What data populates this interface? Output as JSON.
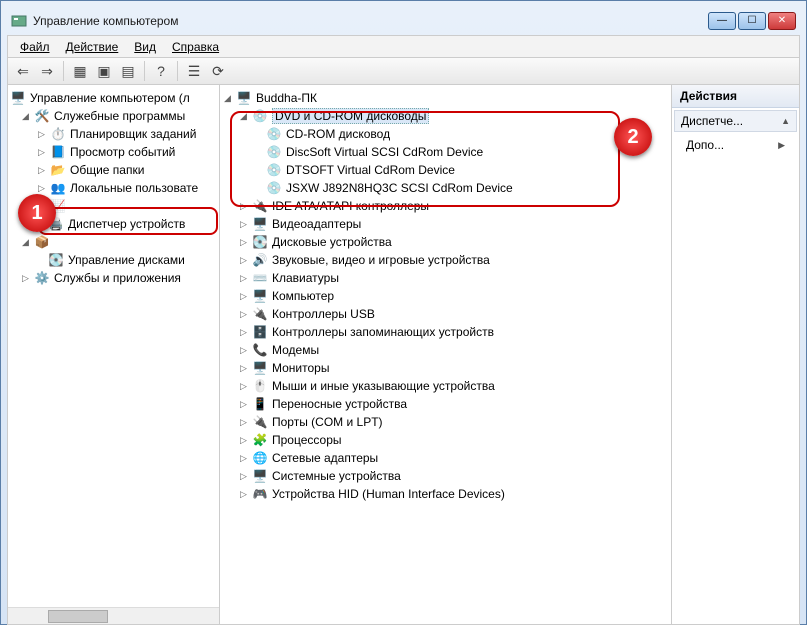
{
  "window": {
    "title": "Управление компьютером"
  },
  "menu": {
    "file": "Файл",
    "action": "Действие",
    "view": "Вид",
    "help": "Справка"
  },
  "left_tree": {
    "root": "Управление компьютером (л",
    "system_tools": "Служебные программы",
    "task_scheduler": "Планировщик заданий",
    "event_viewer": "Просмотр событий",
    "shared_folders": "Общие папки",
    "local_users": "Локальные пользовате",
    "perf": " ",
    "device_manager": "Диспетчер устройств",
    "storage": " ",
    "disk_mgmt": "Управление дисками",
    "services": "Службы и приложения"
  },
  "dev_tree": {
    "root": "Buddha-ПК",
    "dvd_cdrom": "DVD и CD-ROM дисководы",
    "cdrom": "CD-ROM дисковод",
    "discsoft": "DiscSoft Virtual SCSI CdRom Device",
    "dtsoft": "DTSOFT Virtual CdRom Device",
    "jsxw": "JSXW J892N8HQ3C SCSI CdRom Device",
    "ide": "IDE ATA/ATAPI контроллеры",
    "video": "Видеоадаптеры",
    "disk": "Дисковые устройства",
    "sound": "Звуковые, видео и игровые устройства",
    "keyboard": "Клавиатуры",
    "computer": "Компьютер",
    "usb": "Контроллеры USB",
    "storagectl": "Контроллеры запоминающих устройств",
    "modem": "Модемы",
    "monitor": "Мониторы",
    "mouse": "Мыши и иные указывающие устройства",
    "portable": "Переносные устройства",
    "ports": "Порты (COM и LPT)",
    "cpu": "Процессоры",
    "net": "Сетевые адаптеры",
    "system": "Системные устройства",
    "hid": "Устройства HID (Human Interface Devices)"
  },
  "actions": {
    "header": "Действия",
    "sub": "Диспетче...",
    "more": "Допо..."
  },
  "badges": {
    "b1": "1",
    "b2": "2"
  }
}
